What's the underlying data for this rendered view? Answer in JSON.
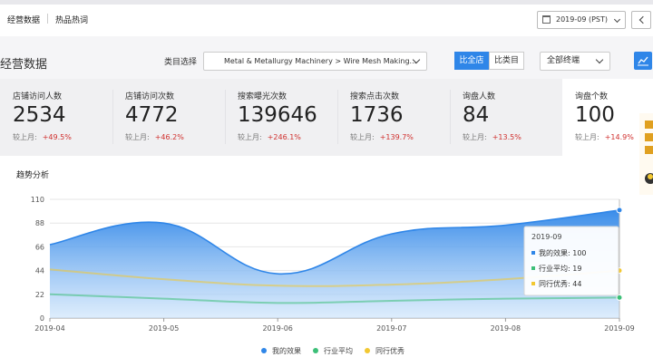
{
  "tabs": [
    {
      "label": "经营数据",
      "active": true
    },
    {
      "label": "热品热词",
      "active": false
    }
  ],
  "date_picker": {
    "value": "2019-09 (PST)",
    "icon": "calendar-icon"
  },
  "page_title": "经营数据",
  "filters": {
    "category_label": "类目选择",
    "category_value": "Metal & Metallurgy Machinery > Wire Mesh Making...",
    "compare_all": "比全店",
    "compare_same": "比类目",
    "terminal": "全部终端"
  },
  "metrics": [
    {
      "label": "店铺访问人数",
      "value": "2534",
      "cmp_label": "较上月:",
      "delta": "+49.5%"
    },
    {
      "label": "店铺访问次数",
      "value": "4772",
      "cmp_label": "较上月:",
      "delta": "+46.2%"
    },
    {
      "label": "搜索曝光次数",
      "value": "139646",
      "cmp_label": "较上月:",
      "delta": "+246.1%"
    },
    {
      "label": "搜索点击次数",
      "value": "1736",
      "cmp_label": "较上月:",
      "delta": "+139.7%"
    },
    {
      "label": "询盘人数",
      "value": "84",
      "cmp_label": "较上月:",
      "delta": "+13.5%"
    },
    {
      "label": "询盘个数",
      "value": "100",
      "cmp_label": "较上月:",
      "delta": "+14.9%",
      "selected": true
    }
  ],
  "trend_title": "趋势分析",
  "colors": {
    "mine": "#2f86e8",
    "industry": "#3cbf78",
    "peers": "#f2c832",
    "delta": "#d0302e"
  },
  "chart_data": {
    "type": "area",
    "x": [
      "2019-04",
      "2019-05",
      "2019-06",
      "2019-07",
      "2019-08",
      "2019-09"
    ],
    "series": [
      {
        "name": "我的效果",
        "values": [
          68,
          88,
          41,
          78,
          86,
          100
        ]
      },
      {
        "name": "行业平均",
        "values": [
          22,
          18,
          14,
          16,
          18,
          19
        ]
      },
      {
        "name": "同行优秀",
        "values": [
          45,
          36,
          30,
          31,
          36,
          44
        ]
      }
    ],
    "yticks": [
      0,
      22,
      44,
      66,
      88,
      110
    ],
    "ylim": [
      0,
      110
    ],
    "grid": true,
    "legend": "bottom-center",
    "tooltip": {
      "title": "2019-09",
      "rows": [
        {
          "name": "我的效果",
          "value": "100"
        },
        {
          "name": "行业平均",
          "value": "19"
        },
        {
          "name": "同行优秀",
          "value": "44"
        }
      ]
    }
  }
}
